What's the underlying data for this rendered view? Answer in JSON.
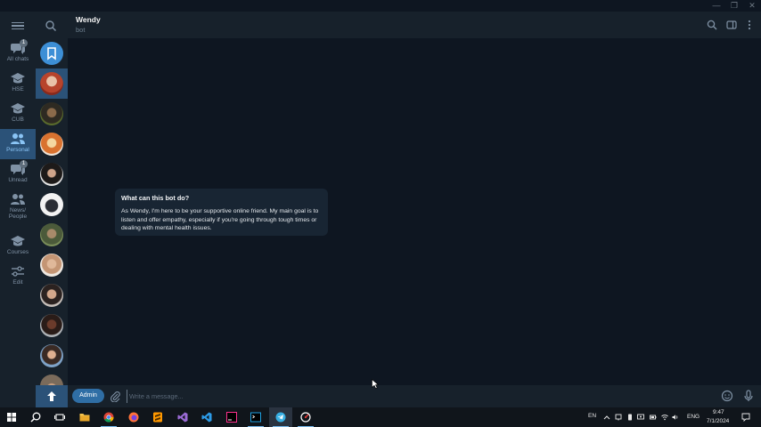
{
  "window": {
    "minimize": "—",
    "restore": "❐",
    "close": "✕"
  },
  "folders": [
    {
      "label": "All chats",
      "badge": "1"
    },
    {
      "label": "HSE"
    },
    {
      "label": "CUB"
    },
    {
      "label": "Personal",
      "active": true
    },
    {
      "label": "Unread",
      "badge": "1"
    },
    {
      "label": "News/ People"
    },
    {
      "label": "Courses"
    },
    {
      "label": "Edit"
    }
  ],
  "header": {
    "name": "Wendy",
    "status": "bot"
  },
  "bubble": {
    "title": "What can this bot do?",
    "text": "As Wendy, I'm here to be your supportive online friend. My main goal is to listen and offer empathy, especially if you're going through tough times or dealing with mental health issues."
  },
  "composer": {
    "admin_label": "Admin",
    "placeholder": "Write a message..."
  },
  "taskbar": {
    "lang": "EN",
    "keyboard": "ENG",
    "time": "9:47",
    "date": "7/1/2024"
  },
  "colors": {
    "accent": "#2b5278",
    "sidebar": "#17212b",
    "chat_bg": "#0e1621",
    "bubble": "#182533"
  }
}
